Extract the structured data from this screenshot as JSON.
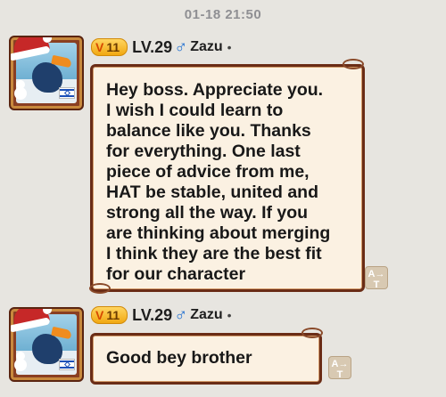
{
  "timestamp": "01-18 21:50",
  "messages": [
    {
      "vip_level": "11",
      "level": "LV.29",
      "gender_symbol": "♂",
      "name": "Zazu",
      "dot": "•",
      "text": "Hey boss. Appreciate you.\nI wish I could learn to\nbalance like you. Thanks\nfor everything. One last\npiece of advice from me,\nHAT be stable, united and\nstrong all the way. If you\nare thinking about merging\nI think they are the best fit\nfor our character",
      "translate_glyph": "A→\nT"
    },
    {
      "vip_level": "11",
      "level": "LV.29",
      "gender_symbol": "♂",
      "name": "Zazu",
      "dot": "•",
      "text": "Good bey brother",
      "translate_glyph": "A→\nT"
    }
  ],
  "colors": {
    "background": "#e7e5e0",
    "bubble_fill": "#fbf1e2",
    "bubble_border": "#6a2c16",
    "vip_gold": "#f1a812",
    "gender_blue": "#1f6fd1"
  }
}
